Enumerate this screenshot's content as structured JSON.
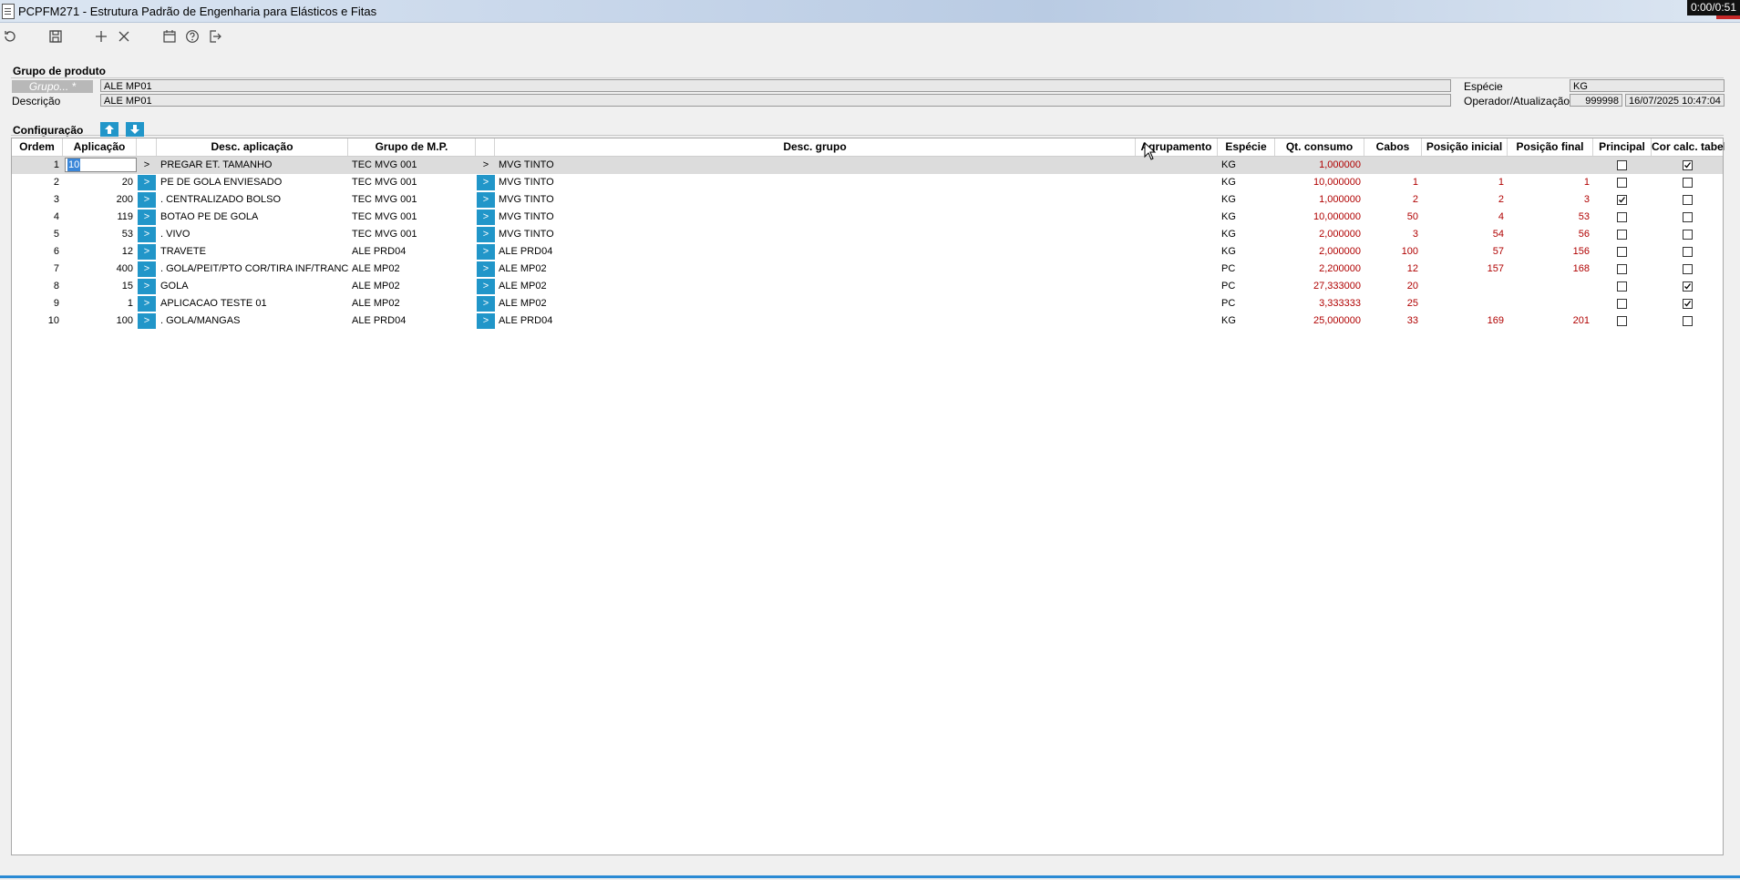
{
  "window": {
    "title": "PCPFM271 - Estrutura Padrão de Engenharia para Elásticos e Fitas",
    "timer": "0:00/0:51"
  },
  "toolbar": {
    "icons": [
      "refresh-icon",
      "save-icon",
      "plus-icon",
      "close-icon",
      "calendar-icon",
      "help-icon",
      "exit-icon"
    ]
  },
  "header": {
    "section_title": "Grupo de produto",
    "grupo_label": "Grupo... *",
    "grupo_value": "ALE MP01",
    "descricao_label": "Descrição",
    "descricao_value": "ALE MP01",
    "especie_label": "Espécie",
    "especie_value": "KG",
    "operador_label": "Operador/Atualização",
    "operador_value": "999998",
    "atualizacao_value": "16/07/2025 10:47:04"
  },
  "config": {
    "section_title": "Configuração"
  },
  "grid": {
    "columns": [
      "Ordem",
      "Aplicação",
      "Desc. aplicação",
      "Grupo de M.P.",
      "Desc. grupo",
      "Agrupamento",
      "Espécie",
      "Qt. consumo",
      "Cabos",
      "Posição inicial",
      "Posição final",
      "Principal",
      "Cor calc. tabela"
    ],
    "rows": [
      {
        "ordem": "1",
        "aplicacao": "10",
        "desc_aplicacao": "PREGAR ET. TAMANHO",
        "grupo_mp": "TEC MVG 001",
        "desc_grupo": "MVG TINTO",
        "agrupamento": "",
        "especie": "KG",
        "qt_consumo": "1,000000",
        "cabos": "",
        "pos_ini": "",
        "pos_fim": "",
        "principal": false,
        "cor_calc": true
      },
      {
        "ordem": "2",
        "aplicacao": "20",
        "desc_aplicacao": "PE DE GOLA ENVIESADO",
        "grupo_mp": "TEC MVG 001",
        "desc_grupo": "MVG TINTO",
        "agrupamento": "",
        "especie": "KG",
        "qt_consumo": "10,000000",
        "cabos": "1",
        "pos_ini": "1",
        "pos_fim": "1",
        "principal": false,
        "cor_calc": false
      },
      {
        "ordem": "3",
        "aplicacao": "200",
        "desc_aplicacao": ". CENTRALIZADO BOLSO",
        "grupo_mp": "TEC MVG 001",
        "desc_grupo": "MVG TINTO",
        "agrupamento": "",
        "especie": "KG",
        "qt_consumo": "1,000000",
        "cabos": "2",
        "pos_ini": "2",
        "pos_fim": "3",
        "principal": true,
        "cor_calc": false
      },
      {
        "ordem": "4",
        "aplicacao": "119",
        "desc_aplicacao": "BOTAO PE DE GOLA",
        "grupo_mp": "TEC MVG 001",
        "desc_grupo": "MVG TINTO",
        "agrupamento": "",
        "especie": "KG",
        "qt_consumo": "10,000000",
        "cabos": "50",
        "pos_ini": "4",
        "pos_fim": "53",
        "principal": false,
        "cor_calc": false
      },
      {
        "ordem": "5",
        "aplicacao": "53",
        "desc_aplicacao": ". VIVO",
        "grupo_mp": "TEC MVG 001",
        "desc_grupo": "MVG TINTO",
        "agrupamento": "",
        "especie": "KG",
        "qt_consumo": "2,000000",
        "cabos": "3",
        "pos_ini": "54",
        "pos_fim": "56",
        "principal": false,
        "cor_calc": false
      },
      {
        "ordem": "6",
        "aplicacao": "12",
        "desc_aplicacao": "TRAVETE",
        "grupo_mp": "ALE PRD04",
        "desc_grupo": "ALE PRD04",
        "agrupamento": "",
        "especie": "KG",
        "qt_consumo": "2,000000",
        "cabos": "100",
        "pos_ini": "57",
        "pos_fim": "156",
        "principal": false,
        "cor_calc": false
      },
      {
        "ordem": "7",
        "aplicacao": "400",
        "desc_aplicacao": ". GOLA/PEIT/PTO COR/TIRA INF/TRANC PUN",
        "grupo_mp": "ALE MP02",
        "desc_grupo": "ALE MP02",
        "agrupamento": "",
        "especie": "PC",
        "qt_consumo": "2,200000",
        "cabos": "12",
        "pos_ini": "157",
        "pos_fim": "168",
        "principal": false,
        "cor_calc": false
      },
      {
        "ordem": "8",
        "aplicacao": "15",
        "desc_aplicacao": "GOLA",
        "grupo_mp": "ALE MP02",
        "desc_grupo": "ALE MP02",
        "agrupamento": "",
        "especie": "PC",
        "qt_consumo": "27,333000",
        "cabos": "20",
        "pos_ini": "",
        "pos_fim": "",
        "principal": false,
        "cor_calc": true
      },
      {
        "ordem": "9",
        "aplicacao": "1",
        "desc_aplicacao": "APLICACAO TESTE 01",
        "grupo_mp": "ALE MP02",
        "desc_grupo": "ALE MP02",
        "agrupamento": "",
        "especie": "PC",
        "qt_consumo": "3,333333",
        "cabos": "25",
        "pos_ini": "",
        "pos_fim": "",
        "principal": false,
        "cor_calc": true
      },
      {
        "ordem": "10",
        "aplicacao": "100",
        "desc_aplicacao": ". GOLA/MANGAS",
        "grupo_mp": "ALE PRD04",
        "desc_grupo": "ALE PRD04",
        "agrupamento": "",
        "especie": "KG",
        "qt_consumo": "25,000000",
        "cabos": "33",
        "pos_ini": "169",
        "pos_fim": "201",
        "principal": false,
        "cor_calc": false
      }
    ],
    "arrow_label": ">"
  },
  "colors": {
    "accent": "#2196c9",
    "selection": "#3a86d8",
    "red_value": "#b00000"
  }
}
